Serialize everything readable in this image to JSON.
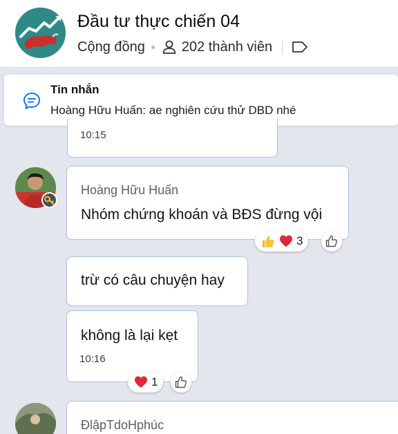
{
  "header": {
    "group_name": "Đầu tư thực chiến 04",
    "group_type": "Cộng đồng",
    "member_count": "202 thành viên",
    "avatar_icon": "bull-group-avatar"
  },
  "pinned": {
    "title": "Tin nhắn",
    "text": "Hoàng Hữu Huấn: ae nghiên cứu thử DBD nhé",
    "icon": "message-icon"
  },
  "messages": [
    {
      "time": "10:15"
    },
    {
      "sender": "Hoàng Hữu Huấn",
      "text": "Nhóm chứng khoán và BĐS đừng vội",
      "reactions": {
        "emojis": [
          "thumbs-up",
          "heart"
        ],
        "count": "3"
      }
    },
    {
      "text": "trừ có câu chuyện hay"
    },
    {
      "text": "không là lại kẹt",
      "time": "10:16",
      "reactions": {
        "emojis": [
          "heart"
        ],
        "count": "1"
      }
    },
    {
      "sender": "ĐlậpTdoHphúc"
    }
  ],
  "colors": {
    "background": "#e3e6ec",
    "bubble_border": "#a9c0e6",
    "accent": "#1a73e8"
  }
}
